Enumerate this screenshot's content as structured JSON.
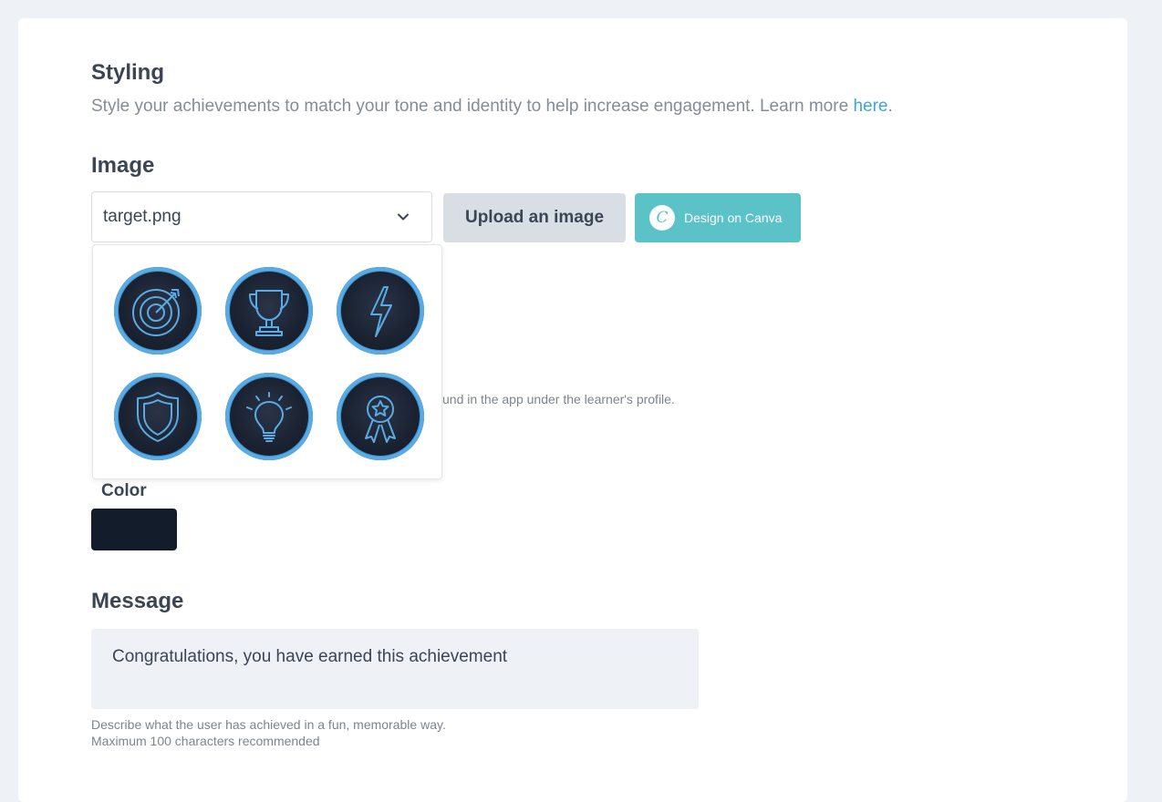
{
  "styling": {
    "title": "Styling",
    "description": "Style your achievements to match your tone and identity to help increase engagement. Learn more ",
    "link_text": "here",
    "trailing": "."
  },
  "image": {
    "title": "Image",
    "select_value": "target.png",
    "upload_label": "Upload an image",
    "canva_label": "Design on Canva",
    "canva_logo_letter": "C",
    "partial_hint": "und in the app under the learner's profile.",
    "options": [
      {
        "icon": "target-icon"
      },
      {
        "icon": "trophy-icon"
      },
      {
        "icon": "lightning-icon"
      },
      {
        "icon": "shield-icon"
      },
      {
        "icon": "lightbulb-icon"
      },
      {
        "icon": "award-ribbon-icon"
      }
    ]
  },
  "color": {
    "label": "Color",
    "value": "#131c2a"
  },
  "message": {
    "title": "Message",
    "value": "Congratulations, you have earned this achievement",
    "help_line1": "Describe what the user has achieved in a fun, memorable way.",
    "help_line2": "Maximum 100 characters recommended"
  },
  "colors": {
    "accent": "#3ea3d6",
    "canva": "#5bc2c8",
    "badge_ring": "#5aabe4"
  }
}
